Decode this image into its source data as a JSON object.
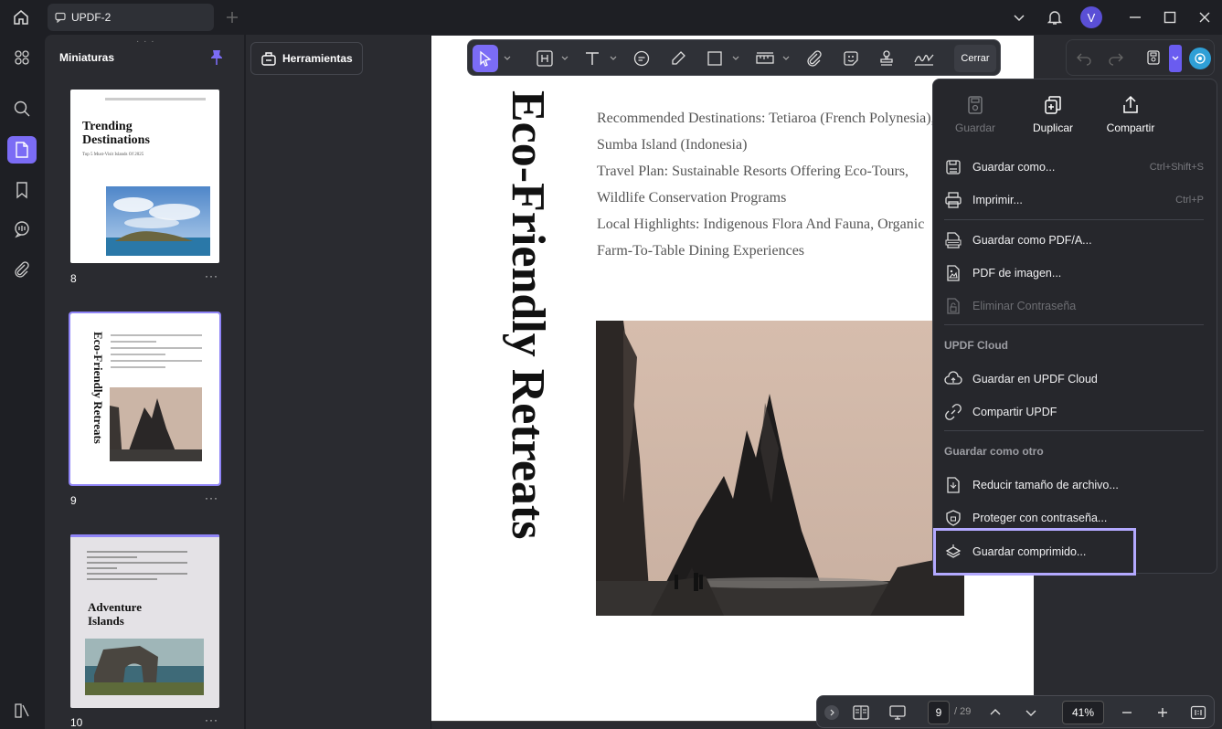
{
  "titlebar": {
    "tab_title": "UPDF-2",
    "avatar_letter": "V"
  },
  "thumbs": {
    "title": "Miniaturas",
    "pages": [
      {
        "num": "8",
        "heading": "Trending Destinations",
        "sub": "Top 5 Must-Visit Islands Of 2025"
      },
      {
        "num": "9",
        "heading": "Eco-Friendly Retreats"
      },
      {
        "num": "10",
        "heading": "Adventure Islands"
      }
    ],
    "more": "···"
  },
  "tools": {
    "label": "Herramientas"
  },
  "toolbar": {
    "close_label": "Cerrar"
  },
  "document": {
    "vertical_title": "Eco-Friendly Retreats",
    "lines": [
      "Recommended Destinations: Tetiaroa (French Polynesia),",
      "Sumba Island (Indonesia)",
      "Travel Plan: Sustainable Resorts Offering Eco-Tours,",
      "Wildlife Conservation Programs",
      "Local Highlights: Indigenous Flora And Fauna, Organic",
      "Farm-To-Table Dining Experiences"
    ]
  },
  "menu": {
    "top_actions": [
      {
        "label": "Guardar",
        "disabled": true
      },
      {
        "label": "Duplicar"
      },
      {
        "label": "Compartir"
      }
    ],
    "save_as": {
      "label": "Guardar como...",
      "shortcut": "Ctrl+Shift+S"
    },
    "print": {
      "label": "Imprimir...",
      "shortcut": "Ctrl+P"
    },
    "save_pdfa": "Guardar como PDF/A...",
    "pdf_image": "PDF de imagen...",
    "remove_password": "Eliminar Contraseña",
    "cloud_section": "UPDF Cloud",
    "save_cloud": "Guardar en UPDF Cloud",
    "share_updf": "Compartir UPDF",
    "other_section": "Guardar como otro",
    "reduce_size": "Reducir tamaño de archivo...",
    "protect": "Proteger con contraseña...",
    "save_compressed": "Guardar comprimido..."
  },
  "bottombar": {
    "page_current": "9",
    "page_total": "/ 29",
    "zoom": "41%"
  },
  "colors": {
    "accent": "#7b6cf5",
    "highlight": "#b3a9ff",
    "background": "#1e1f24",
    "panel": "#2a2b30"
  }
}
